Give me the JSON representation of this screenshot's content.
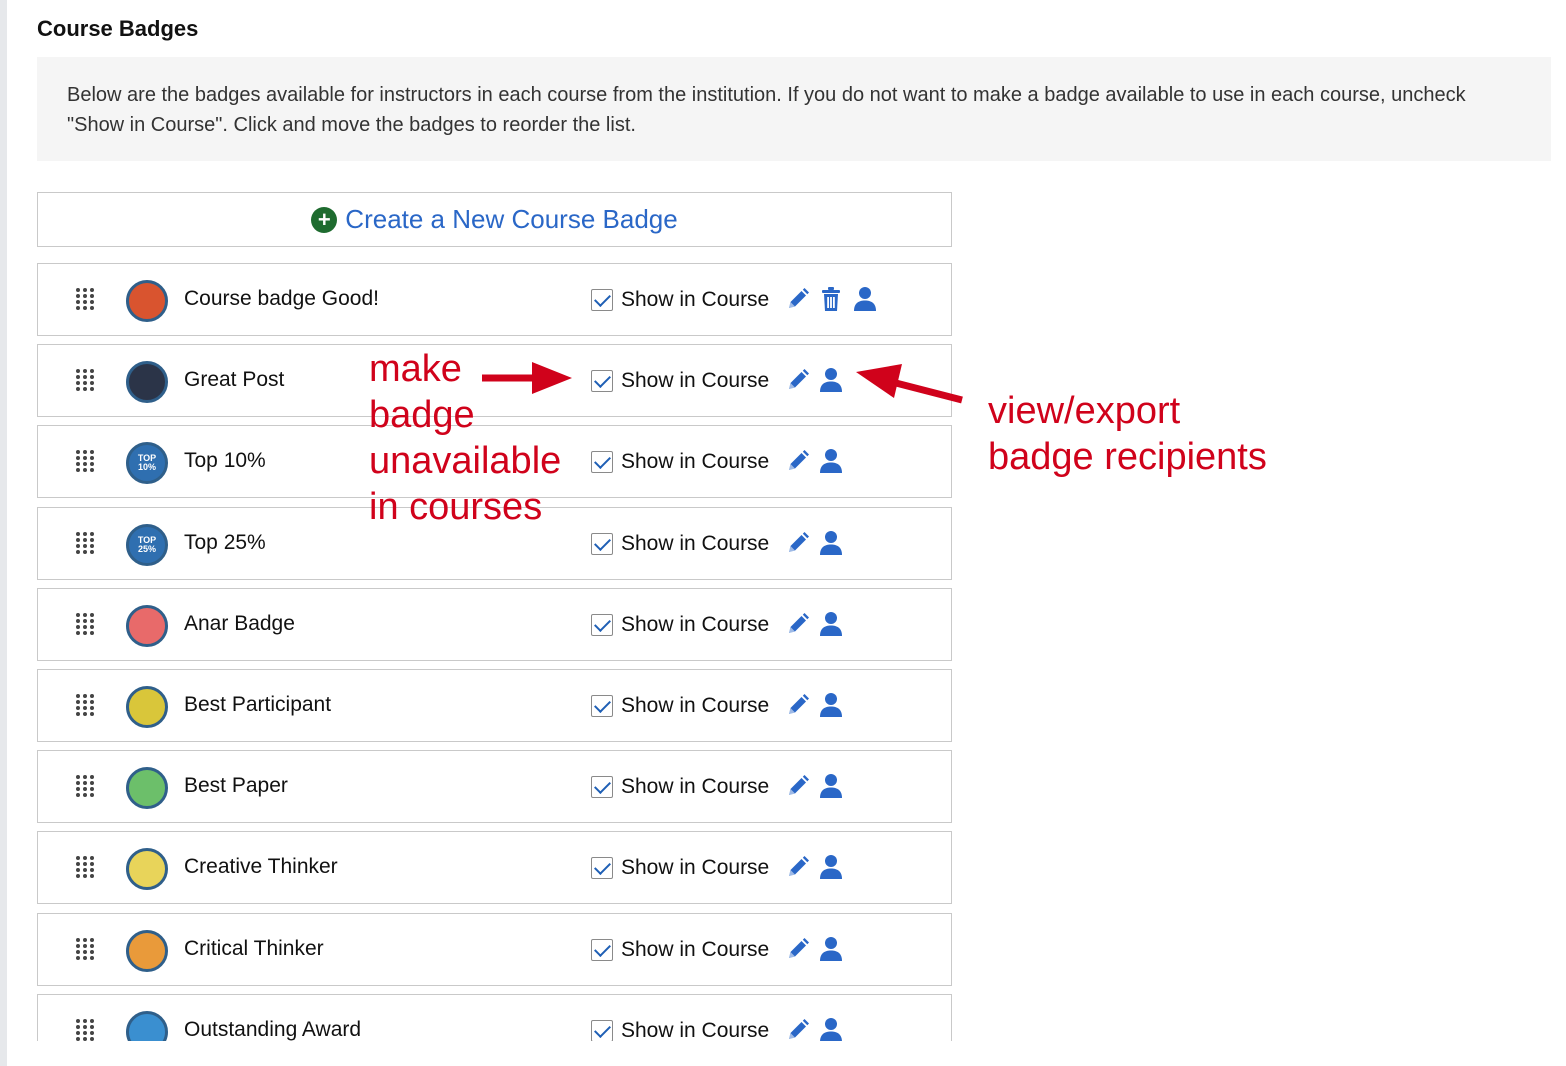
{
  "page": {
    "title": "Course Badges",
    "description": "Below are the badges available for instructors in each course from the institution. If you do not want to make a badge available to use in each course, uncheck \"Show in Course\". Click and move the badges to reorder the list.",
    "create_label": "Create a New Course Badge",
    "show_label": "Show in Course"
  },
  "badges": [
    {
      "name": "Course badge Good!",
      "checked": true,
      "deletable": true,
      "icon": "treasure-chest-badge-icon",
      "color": "#d9542f"
    },
    {
      "name": "Great Post",
      "checked": true,
      "deletable": false,
      "icon": "great-post-badge-icon",
      "color": "#2b3448"
    },
    {
      "name": "Top 10%",
      "checked": true,
      "deletable": false,
      "icon": "top-10-badge-icon",
      "color": "#2f6fb0",
      "badge_text": "TOP 10%"
    },
    {
      "name": "Top 25%",
      "checked": true,
      "deletable": false,
      "icon": "top-25-badge-icon",
      "color": "#2f6fb0",
      "badge_text": "TOP 25%"
    },
    {
      "name": "Anar Badge",
      "checked": true,
      "deletable": false,
      "icon": "pomegranate-badge-icon",
      "color": "#e86a6a"
    },
    {
      "name": "Best Participant",
      "checked": true,
      "deletable": false,
      "icon": "raised-hand-badge-icon",
      "color": "#d9c63a"
    },
    {
      "name": "Best Paper",
      "checked": true,
      "deletable": false,
      "icon": "paper-badge-icon",
      "color": "#6cbf6a"
    },
    {
      "name": "Creative Thinker",
      "checked": true,
      "deletable": false,
      "icon": "lightbulb-badge-icon",
      "color": "#e8d45a"
    },
    {
      "name": "Critical Thinker",
      "checked": true,
      "deletable": false,
      "icon": "thinking-head-badge-icon",
      "color": "#e99a3a"
    },
    {
      "name": "Outstanding Award",
      "checked": true,
      "deletable": false,
      "icon": "trophy-badge-icon",
      "color": "#3a8fd0"
    }
  ],
  "annotations": {
    "left_lines": [
      "make",
      "badge",
      "unavailable",
      "in courses"
    ],
    "right_lines": [
      "view/export",
      "badge recipients"
    ],
    "color": "#d0021b"
  },
  "colors": {
    "accent_blue": "#2a67c7",
    "add_green": "#1e6b2f",
    "border": "#c9c9c9",
    "info_bg": "#f5f5f5"
  }
}
